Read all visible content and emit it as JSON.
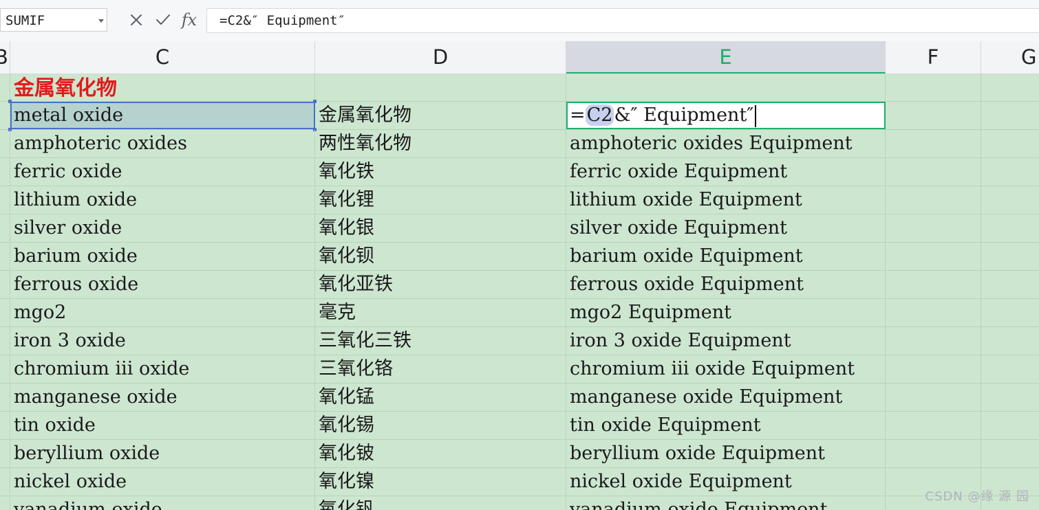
{
  "name_box": {
    "value": "SUMIF"
  },
  "formula_bar": {
    "cancel_symbol": "×",
    "enter_symbol": "✓",
    "fx_label": "fx",
    "formula": "=C2&″ Equipment″"
  },
  "columns": [
    "B",
    "C",
    "D",
    "E",
    "F",
    "G"
  ],
  "active_column": "E",
  "title_cell": "金属氧化物",
  "editing_cell": {
    "prefix": "=",
    "reference": "C2",
    "suffix": "&″ Equipment″"
  },
  "rows": [
    {
      "c": "metal oxide",
      "d": "金属氧化物",
      "e": ""
    },
    {
      "c": "amphoteric oxides",
      "d": "两性氧化物",
      "e": "amphoteric oxides Equipment"
    },
    {
      "c": "ferric oxide",
      "d": "氧化铁",
      "e": "ferric oxide Equipment"
    },
    {
      "c": "lithium oxide",
      "d": "氧化锂",
      "e": "lithium oxide Equipment"
    },
    {
      "c": "silver oxide",
      "d": "氧化银",
      "e": "silver oxide Equipment"
    },
    {
      "c": "barium oxide",
      "d": "氧化钡",
      "e": "barium oxide Equipment"
    },
    {
      "c": "ferrous oxide",
      "d": "氧化亚铁",
      "e": "ferrous oxide Equipment"
    },
    {
      "c": "mgo2",
      "d": "毫克",
      "e": "mgo2 Equipment"
    },
    {
      "c": "iron 3 oxide",
      "d": "三氧化三铁",
      "e": "iron 3 oxide Equipment"
    },
    {
      "c": "chromium iii oxide",
      "d": "三氧化铬",
      "e": "chromium iii oxide Equipment"
    },
    {
      "c": "manganese oxide",
      "d": "氧化锰",
      "e": "manganese oxide Equipment"
    },
    {
      "c": "tin oxide",
      "d": "氧化锡",
      "e": "tin oxide Equipment"
    },
    {
      "c": "beryllium oxide",
      "d": "氧化铍",
      "e": "beryllium oxide Equipment"
    },
    {
      "c": "nickel oxide",
      "d": "氧化镍",
      "e": "nickel oxide Equipment"
    },
    {
      "c": "vanadium oxide",
      "d": "氧化钒",
      "e": "vanadium oxide Equipment"
    }
  ],
  "watermark": "CSDN @缘  源  园",
  "colors": {
    "grid_bg": "#cde6d0",
    "active_header": "#1fae6a",
    "title_red": "#e21b1b",
    "selection_blue": "#4a6fd0"
  }
}
